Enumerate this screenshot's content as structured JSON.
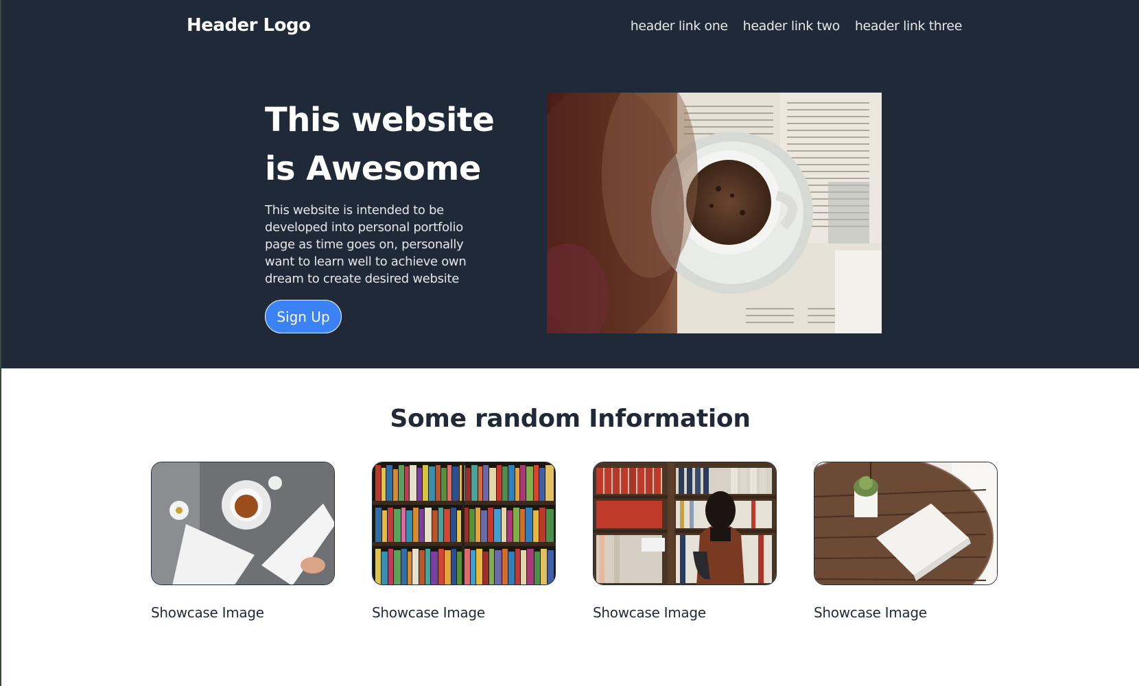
{
  "header": {
    "logo": "Header Logo",
    "links": [
      "header link one",
      "header link two",
      "header link three"
    ]
  },
  "hero": {
    "title": "This website is Awesome",
    "description": "This website is intended to be developed into personal portfolio page as time goes on, personally want to learn well to achieve own dream to create desired website",
    "button_label": "Sign Up"
  },
  "info": {
    "title": "Some random Information",
    "cards": [
      {
        "caption": "Showcase Image"
      },
      {
        "caption": "Showcase Image"
      },
      {
        "caption": "Showcase Image"
      },
      {
        "caption": "Showcase Image"
      }
    ]
  },
  "colors": {
    "hero_background": "#1f2937",
    "button": "#3b82f6",
    "text_dark": "#1f2937"
  }
}
